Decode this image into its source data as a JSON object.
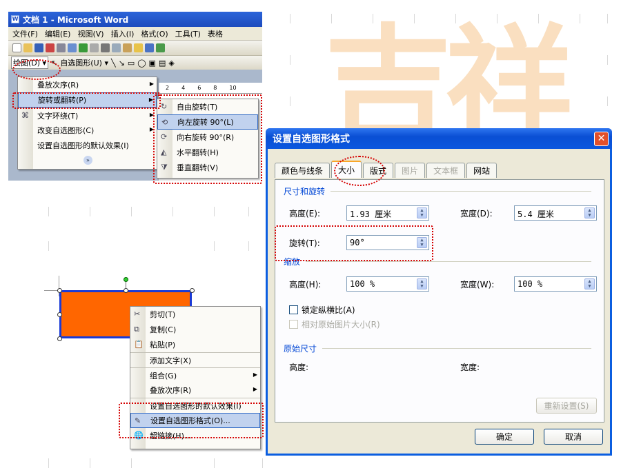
{
  "word": {
    "title": "文档 1 - Microsoft Word",
    "menu": [
      "文件(F)",
      "编辑(E)",
      "视图(V)",
      "插入(I)",
      "格式(O)",
      "工具(T)",
      "表格"
    ],
    "draw_label": "绘图(D)",
    "autoshape_label": "自选图形(U)",
    "draw_menu": [
      {
        "label": "叠放次序(R)",
        "sub": true
      },
      {
        "label": "旋转或翻转(P)",
        "sub": true,
        "selected": true
      },
      {
        "label": "文字环绕(T)",
        "sub": true
      },
      {
        "label": "改变自选图形(C)",
        "sub": true
      },
      {
        "label": "设置自选图形的默认效果(I)",
        "sub": false
      }
    ],
    "ruler": [
      "2",
      "4",
      "6",
      "8",
      "10"
    ],
    "rotate_menu": [
      "自由旋转(T)",
      "向左旋转 90°(L)",
      "向右旋转 90°(R)",
      "水平翻转(H)",
      "垂直翻转(V)"
    ]
  },
  "context_menu": [
    "剪切(T)",
    "复制(C)",
    "粘贴(P)",
    "添加文字(X)",
    "组合(G)",
    "叠放次序(R)",
    "设置自选图形的默认效果(I)",
    "设置自选图形格式(O)...",
    "超链接(H)..."
  ],
  "shape": {
    "fill": "#ff6600",
    "border": "#1a3ad6"
  },
  "dialog": {
    "title": "设置自选图形格式",
    "tabs": [
      "颜色与线条",
      "大小",
      "版式",
      "图片",
      "文本框",
      "网站"
    ],
    "size_section": "尺寸和旋转",
    "height_label": "高度(E):",
    "height_value": "1.93 厘米",
    "width_label": "宽度(D):",
    "width_value": "5.4 厘米",
    "rotate_label": "旋转(T):",
    "rotate_value": "90°",
    "scale_section": "缩放",
    "scale_height_label": "高度(H):",
    "scale_height_value": "100 %",
    "scale_width_label": "宽度(W):",
    "scale_width_value": "100 %",
    "lock_ratio": "锁定纵横比(A)",
    "relative_original": "相对原始图片大小(R)",
    "original_section": "原始尺寸",
    "orig_height": "高度:",
    "orig_width": "宽度:",
    "reset": "重新设置(S)",
    "ok": "确定",
    "cancel": "取消"
  },
  "watermark": "吉祥"
}
